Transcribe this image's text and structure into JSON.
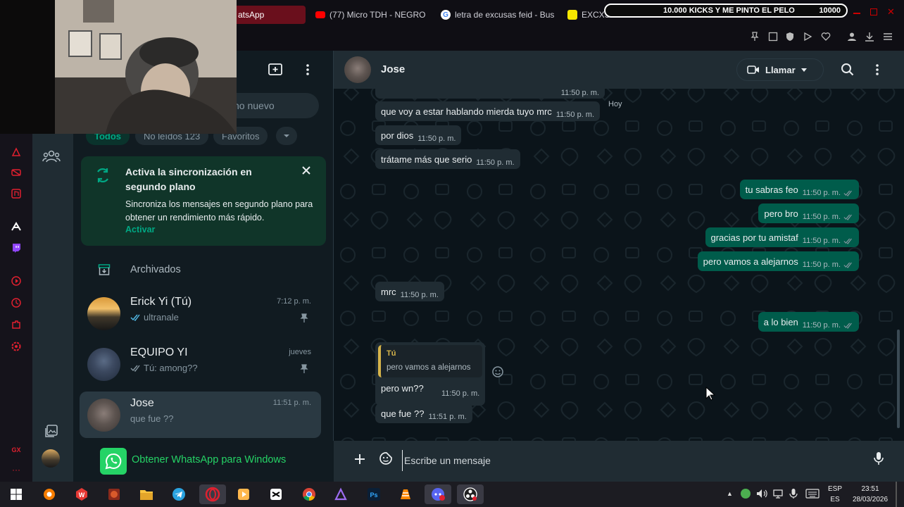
{
  "browser": {
    "tabs": [
      {
        "label": "atsApp",
        "active": true
      },
      {
        "label": "(77) Micro TDH - NEGRO",
        "active": false
      },
      {
        "label": "letra de excusas feid - Bus",
        "active": false
      },
      {
        "label": "EXCXSXS - Feid - LETRA",
        "active": false
      }
    ],
    "goal_text": "10.000 KICKS Y ME PINTO EL PELO",
    "goal_value": "10000"
  },
  "chatlist": {
    "search_placeholder": "no nuevo",
    "filters": [
      "Todos",
      "No leídos 123",
      "Favoritos"
    ],
    "sync_banner": {
      "title": "Activa la sincronización en segundo plano",
      "body": "Sincroniza los mensajes en segundo plano para obtener un rendimiento más rápido.",
      "action": "Activar"
    },
    "archived_label": "Archivados",
    "chats": [
      {
        "name": "Erick Yi (Tú)",
        "preview": "ultranale",
        "time": "7:12 p. m.",
        "pinned": true
      },
      {
        "name": "EQUIPO YI",
        "preview": "Tú: among??",
        "time": "jueves",
        "pinned": true
      },
      {
        "name": "Jose",
        "preview": "que fue ??",
        "time": "11:51 p. m.",
        "pinned": false
      }
    ],
    "get_app_label": "Obtener WhatsApp para Windows"
  },
  "chat": {
    "contact_name": "Jose",
    "call_label": "Llamar",
    "day_label": "Hoy",
    "messages": [
      {
        "dir": "in",
        "text": "que voy a estar hablando mierda tuyo mrc",
        "time": "11:50 p. m."
      },
      {
        "dir": "in",
        "text": "por dios",
        "time": "11:50 p. m."
      },
      {
        "dir": "in",
        "text": "trátame más que serio",
        "time": "11:50 p. m."
      },
      {
        "dir": "out",
        "text": "tu sabras feo",
        "time": "11:50 p. m."
      },
      {
        "dir": "out",
        "text": "pero bro",
        "time": "11:50 p. m."
      },
      {
        "dir": "out",
        "text": "gracias por tu amistaf",
        "time": "11:50 p. m."
      },
      {
        "dir": "out",
        "text": "pero vamos a alejarnos",
        "time": "11:50 p. m."
      },
      {
        "dir": "in",
        "text": "mrc",
        "time": "11:50 p. m."
      },
      {
        "dir": "out",
        "text": "a lo bien",
        "time": "11:50 p. m."
      },
      {
        "dir": "in",
        "text": "pero wn??",
        "time": "11:50 p. m."
      },
      {
        "dir": "in",
        "text": "que fue ??",
        "time": "11:51 p. m."
      }
    ],
    "quote": {
      "author": "Tú",
      "text": "pero vamos a alejarnos"
    },
    "composer_placeholder": "Escribe un mensaje"
  },
  "taskbar": {
    "lang": "ESP",
    "lang2": "ES",
    "time": "23:51",
    "date": "28/03/2026"
  },
  "colors": {
    "wa_green": "#00a884",
    "out_bubble": "#005c4b",
    "in_bubble": "#202c33",
    "bg": "#0b141a",
    "opera_red": "#e0202f"
  }
}
